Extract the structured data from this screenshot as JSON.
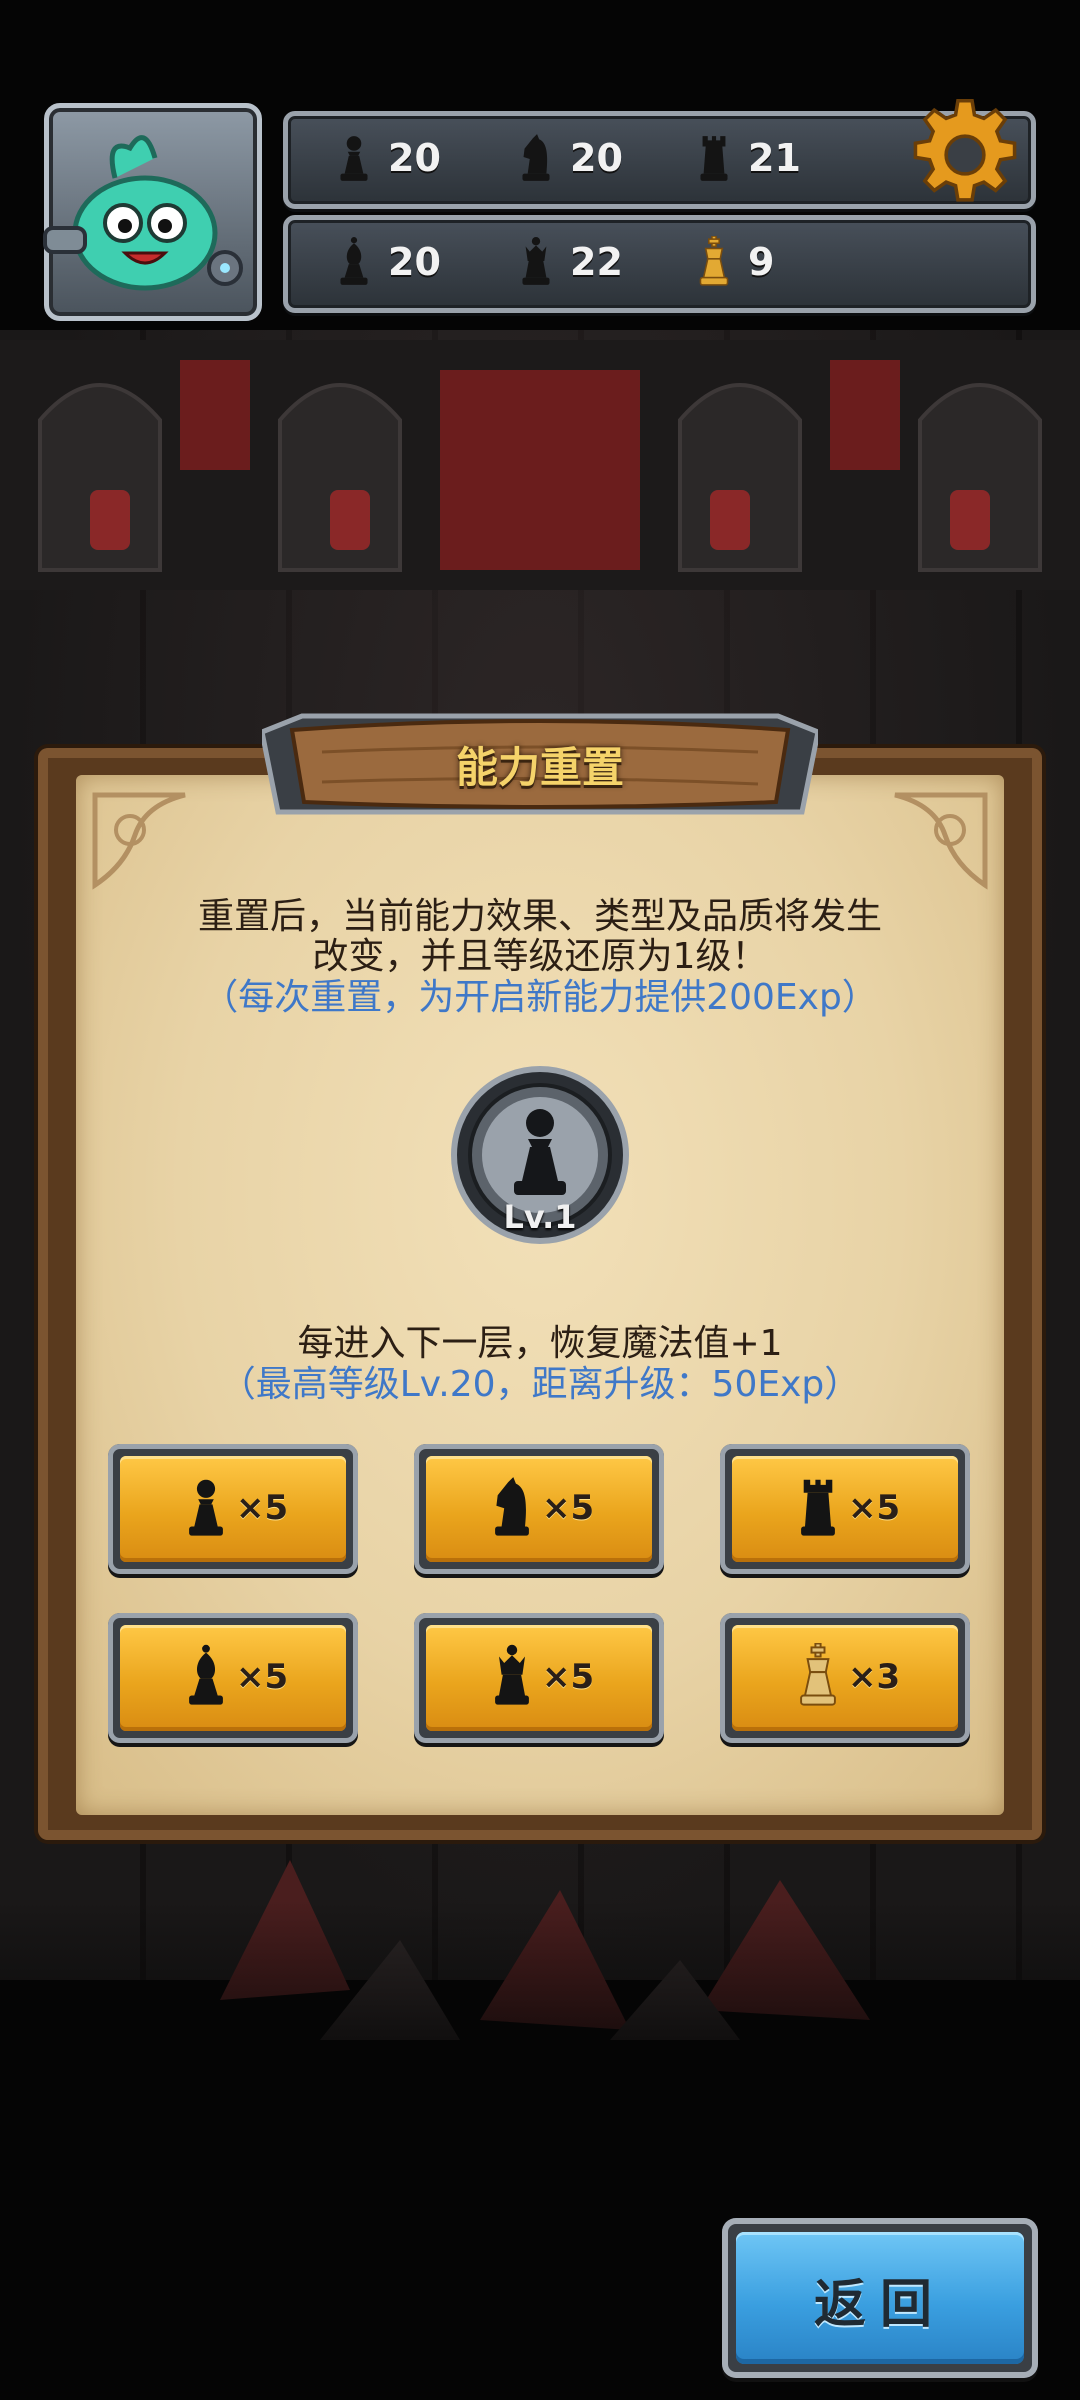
{
  "resources": {
    "row1": [
      {
        "icon": "pawn-icon",
        "value": "20"
      },
      {
        "icon": "knight-icon",
        "value": "20"
      },
      {
        "icon": "rook-icon",
        "value": "21"
      }
    ],
    "row2": [
      {
        "icon": "bishop-icon",
        "value": "20"
      },
      {
        "icon": "queen-icon",
        "value": "22"
      },
      {
        "icon": "gold-king-icon",
        "value": "9"
      }
    ]
  },
  "dialog": {
    "title": "能力重置",
    "desc_line1": "重置后，当前能力效果、类型及品质将发生",
    "desc_line2": "改变，并且等级还原为1级！",
    "desc_note": "（每次重置，为开启新能力提供200Exp）",
    "ability_level": "Lv.1",
    "effect_text": "每进入下一层，恢复魔法值+1",
    "effect_note": "（最高等级Lv.20，距离升级：50Exp）"
  },
  "costs": [
    {
      "icon": "pawn-icon",
      "qty": "×5"
    },
    {
      "icon": "knight-icon",
      "qty": "×5"
    },
    {
      "icon": "rook-icon",
      "qty": "×5"
    },
    {
      "icon": "bishop-icon",
      "qty": "×5"
    },
    {
      "icon": "queen-icon",
      "qty": "×5"
    },
    {
      "icon": "gold-king-icon",
      "qty": "×3"
    }
  ],
  "back_label": "返回",
  "colors": {
    "accent_gold": "#f5d36a",
    "note_blue": "#3f78c8",
    "button_orange": "#eaa51d",
    "button_blue": "#3a9fe0"
  }
}
